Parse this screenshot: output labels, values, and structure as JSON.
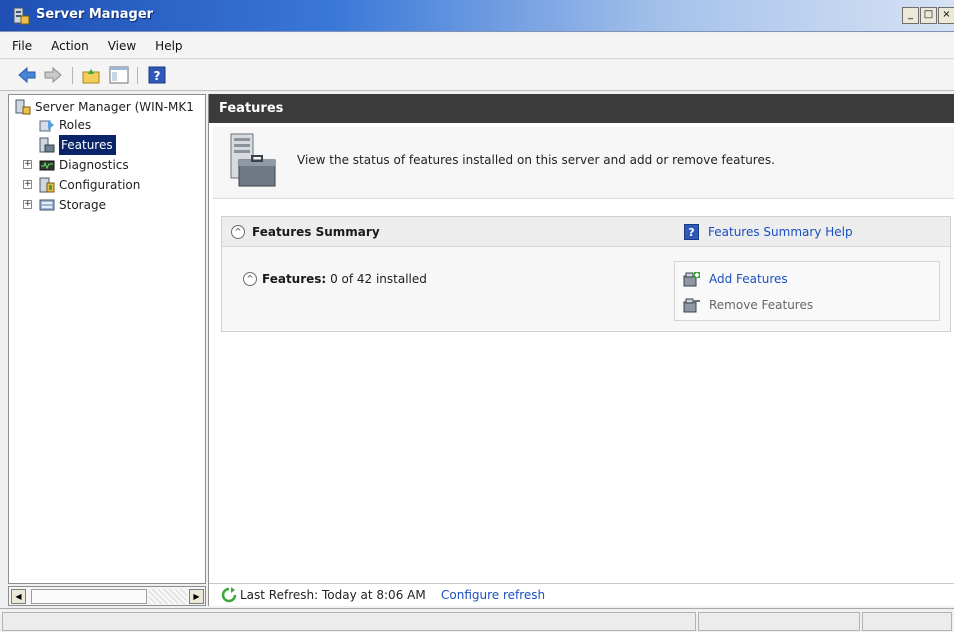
{
  "window": {
    "title": "Server Manager",
    "controls": {
      "minimize": "_",
      "maximize": "□",
      "close": "×"
    }
  },
  "menu": {
    "items": [
      "File",
      "Action",
      "View",
      "Help"
    ]
  },
  "toolbar": {
    "icons": [
      "back-arrow-icon",
      "forward-arrow-icon",
      "up-folder-icon",
      "show-hide-console-tree-icon",
      "help-icon"
    ]
  },
  "tree": {
    "root_label": "Server Manager (WIN-MK1",
    "items": [
      {
        "label": "Roles",
        "icon": "roles-icon",
        "expandable": false,
        "selected": false
      },
      {
        "label": "Features",
        "icon": "features-icon",
        "expandable": false,
        "selected": true
      },
      {
        "label": "Diagnostics",
        "icon": "diagnostics-icon",
        "expandable": true,
        "selected": false
      },
      {
        "label": "Configuration",
        "icon": "configuration-icon",
        "expandable": true,
        "selected": false
      },
      {
        "label": "Storage",
        "icon": "storage-icon",
        "expandable": true,
        "selected": false
      }
    ],
    "expander_glyph": "+"
  },
  "scrollbar": {
    "left_arrow": "◀",
    "right_arrow": "▶"
  },
  "content": {
    "header": "Features",
    "intro_text": "View the status of features installed on this server and add or remove features.",
    "summary": {
      "title": "Features Summary",
      "help_link": "Features Summary Help",
      "help_glyph": "?",
      "collapse_glyph": "^",
      "features_label": "Features:",
      "features_count": "0 of 42 installed",
      "actions": {
        "add": "Add Features",
        "remove": "Remove Features"
      }
    },
    "refresh": {
      "text": "Last Refresh: Today at 8:06 AM",
      "configure_link": "Configure refresh"
    }
  },
  "colors": {
    "header_bg": "#3b3b3b",
    "link": "#1a4fbf",
    "selection": "#0a246a",
    "titlebar_start": "#1f4fb4"
  }
}
